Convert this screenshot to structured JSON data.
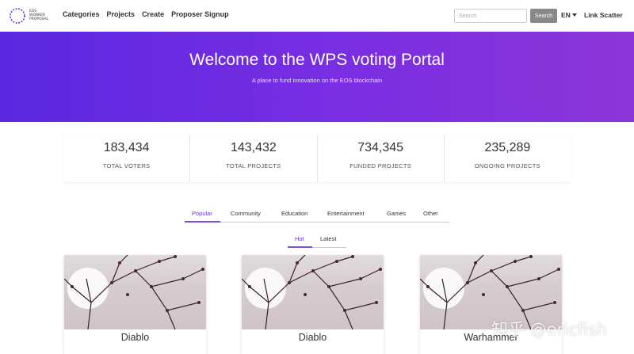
{
  "logo": {
    "lines": [
      "EOS",
      "WORKER",
      "PROPOSAL"
    ]
  },
  "nav": {
    "links": [
      "Categories",
      "Projects",
      "Create",
      "Proposer Signup"
    ],
    "search_placeholder": "Search",
    "search_button": "Search",
    "language": "EN",
    "scatter_link": "Link Scatter"
  },
  "hero": {
    "title": "Welcome to the WPS voting Portal",
    "subtitle": "A place to fund innovation on the EOS blockchain"
  },
  "stats": [
    {
      "value": "183,434",
      "label": "TOTAL VOTERS"
    },
    {
      "value": "143,432",
      "label": "TOTAL PROJECTS"
    },
    {
      "value": "734,345",
      "label": "FUNDED PROJECTS"
    },
    {
      "value": "235,289",
      "label": "ONGOING PROJECTS"
    }
  ],
  "category_tabs": [
    "Popular",
    "Community",
    "Education",
    "Entertainment",
    "Games",
    "Other"
  ],
  "category_active": "Popular",
  "sort_tabs": [
    "Hot",
    "Latest"
  ],
  "sort_active": "Hot",
  "cards": [
    {
      "title": "Diablo"
    },
    {
      "title": "Diablo"
    },
    {
      "title": "Warhammer"
    }
  ],
  "watermark": "知乎 @ericfish",
  "colors": {
    "hero_start": "#5a28e0",
    "hero_end": "#8c35d9",
    "accent": "#7b4fe0",
    "search_button": "#888888"
  }
}
